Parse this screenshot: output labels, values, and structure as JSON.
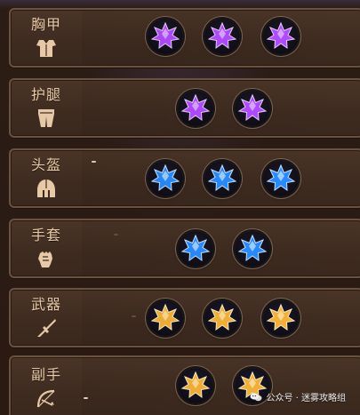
{
  "equipment_slots": [
    {
      "name": "胸甲",
      "icon": "chest-armor-icon",
      "gem_color": "purple",
      "gem_count": 3
    },
    {
      "name": "护腿",
      "icon": "leg-armor-icon",
      "gem_color": "purple",
      "gem_count": 2
    },
    {
      "name": "头盔",
      "icon": "helmet-icon",
      "gem_color": "blue",
      "gem_count": 3
    },
    {
      "name": "手套",
      "icon": "gloves-icon",
      "gem_color": "blue",
      "gem_count": 2
    },
    {
      "name": "武器",
      "icon": "weapon-icon",
      "gem_color": "gold",
      "gem_count": 3
    },
    {
      "name": "副手",
      "icon": "offhand-bow-icon",
      "gem_color": "gold",
      "gem_count": 2
    }
  ],
  "colors": {
    "purple": "#a64cff",
    "blue": "#2a8cff",
    "gold": "#f6b23b",
    "label": "#e7c9a7"
  },
  "watermark": {
    "icon": "wechat-public-account-icon",
    "text": "公众号 · 迷雾攻略组"
  }
}
